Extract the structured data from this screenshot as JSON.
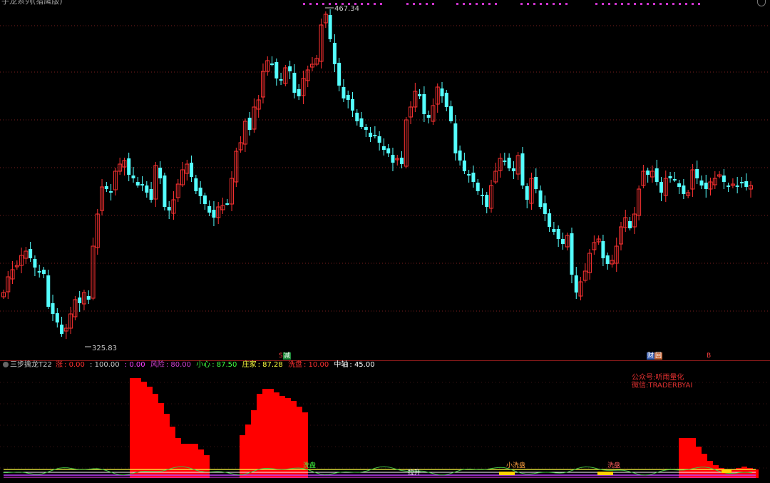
{
  "app": {
    "top_title": "子龙系列(猎鹰版)"
  },
  "main_chart": {
    "high_label": "467.34",
    "low_label": "325.83",
    "markers": [
      {
        "id": "m1",
        "text": "减",
        "color": "#ffffff",
        "bg": "#1e8a3a"
      },
      {
        "id": "m2",
        "text": "财",
        "color": "#ffffff",
        "bg": "#3a5fb0"
      },
      {
        "id": "m3",
        "text": "回",
        "color": "#ffffff",
        "bg": "#c06030"
      },
      {
        "id": "m4",
        "text": "S",
        "color": "#ff4040",
        "bg": ""
      },
      {
        "id": "m5",
        "text": "B",
        "color": "#ff4040",
        "bg": ""
      }
    ]
  },
  "indicator": {
    "name": "三步擒龙T22",
    "items": [
      {
        "label": "涨",
        "value": "0.00",
        "color": "#ff3030"
      },
      {
        "label": "",
        "value": "100.00",
        "color": "#cccccc"
      },
      {
        "label": "",
        "value": "0.00",
        "color": "#ff40ff"
      },
      {
        "label": "风险",
        "value": "80.00",
        "color": "#d040d0"
      },
      {
        "label": "小心",
        "value": "87.50",
        "color": "#40ff40"
      },
      {
        "label": "庄家",
        "value": "87.28",
        "color": "#ffff40"
      },
      {
        "label": "洗盘",
        "value": "10.00",
        "color": "#ff3030"
      },
      {
        "label": "中轴",
        "value": "45.00",
        "color": "#ffffff"
      }
    ],
    "sub_labels": [
      "洗盘",
      "拉升",
      "小洗盘",
      "洗盘"
    ]
  },
  "watermark": {
    "line1": "公众号:听雨量化",
    "line2": "微信:TRADERBYAI"
  },
  "colors": {
    "up": "#ff3232",
    "down": "#54ffff",
    "grid": "#7a1e1e",
    "sub_bar": "#ff0000"
  },
  "chart_data": {
    "type": "candlestick",
    "high": 467.34,
    "low": 325.83,
    "candles": [
      [
        -8.4,
        -9.1,
        -7.8,
        -9.7
      ],
      [
        -8.8,
        -7.4,
        -6.8,
        -8.8
      ],
      [
        -8.0,
        -8.2,
        -7.6,
        -8.6
      ],
      [
        -7.7,
        -6.9,
        -6.2,
        -7.8
      ],
      [
        -7.3,
        -7.8,
        -6.6,
        -8.0
      ],
      [
        -7.5,
        -7.3,
        -6.4,
        -7.6
      ],
      [
        -7.6,
        -7.7,
        -7.2,
        -7.8
      ],
      [
        -7.7,
        -7.3,
        -7.0,
        -7.8
      ],
      [
        -7.4,
        -6.6,
        -6.4,
        -7.4
      ],
      [
        -6.5,
        -7.6,
        -6.4,
        -7.8
      ],
      [
        -6.9,
        -7.7,
        -6.9,
        -7.9
      ],
      [
        -7.8,
        -8.0,
        -7.7,
        -8.2
      ],
      [
        -9.0,
        -9.8,
        -8.8,
        -10.0
      ],
      [
        -9.5,
        -10.2,
        -9.4,
        -10.5
      ],
      [
        -10.2,
        -10.4,
        -10.1,
        -10.6
      ],
      [
        -10.4,
        -10.1,
        -9.9,
        -10.5
      ],
      [
        -10.3,
        -10.5,
        -10.0,
        -11.0
      ],
      [
        -10.0,
        -9.6,
        -9.2,
        -10.1
      ],
      [
        -9.7,
        -8.9,
        -8.6,
        -9.8
      ],
      [
        -9.2,
        -8.5,
        -8.3,
        -9.3
      ],
      [
        -9.4,
        -8.6,
        -8.2,
        -9.4
      ],
      [
        -8.8,
        -8.3,
        -7.3,
        -8.9
      ],
      [
        -8.5,
        -8.6,
        -8.4,
        -8.8
      ],
      [
        -8.7,
        -7.1,
        -6.9,
        -8.8
      ]
    ]
  },
  "sub_chart_data": {
    "type": "bar",
    "blocks": [
      {
        "start": 182,
        "heights": [
          140,
          140,
          135,
          128,
          118,
          105,
          90,
          72,
          56,
          48,
          48,
          48,
          40,
          32
        ]
      },
      {
        "start": 336,
        "heights": [
          60,
          75,
          95,
          118,
          125,
          125,
          120,
          115,
          112,
          108,
          100,
          92
        ]
      },
      {
        "start": 952,
        "heights": [
          56,
          56,
          56,
          44,
          34,
          24,
          18,
          14,
          12,
          12,
          14,
          16,
          14,
          12
        ]
      }
    ],
    "bar_width": 8
  }
}
